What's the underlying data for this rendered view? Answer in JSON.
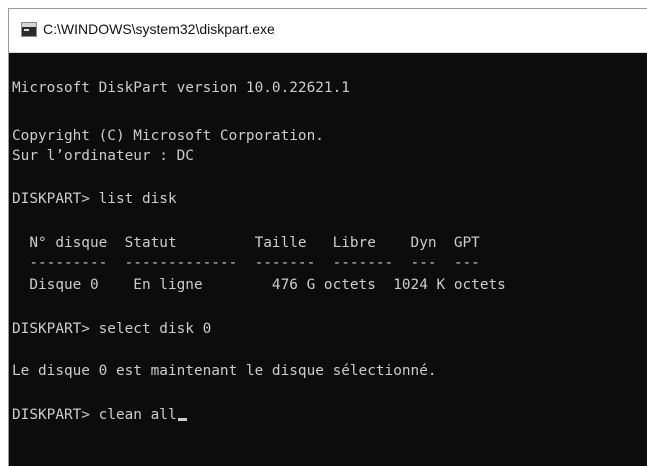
{
  "window": {
    "title": "C:\\WINDOWS\\system32\\diskpart.exe",
    "icon": "console-app-icon"
  },
  "console": {
    "lines": [
      "Microsoft DiskPart version 10.0.22621.1",
      "Copyright (C) Microsoft Corporation.",
      "Sur l’ordinateur : DC",
      "DISKPART> list disk",
      "  N° disque  Statut         Taille   Libre    Dyn  GPT",
      "  ---------  -------------  -------  -------  ---  ---",
      "  Disque 0    En ligne        476 G octets  1024 K octets",
      "DISKPART> select disk 0",
      "Le disque 0 est maintenant le disque sélectionné.",
      "DISKPART> clean all"
    ]
  },
  "colors": {
    "console_background": "#0c0c0c",
    "console_text": "#cccccc",
    "titlebar_background": "#ffffff"
  }
}
